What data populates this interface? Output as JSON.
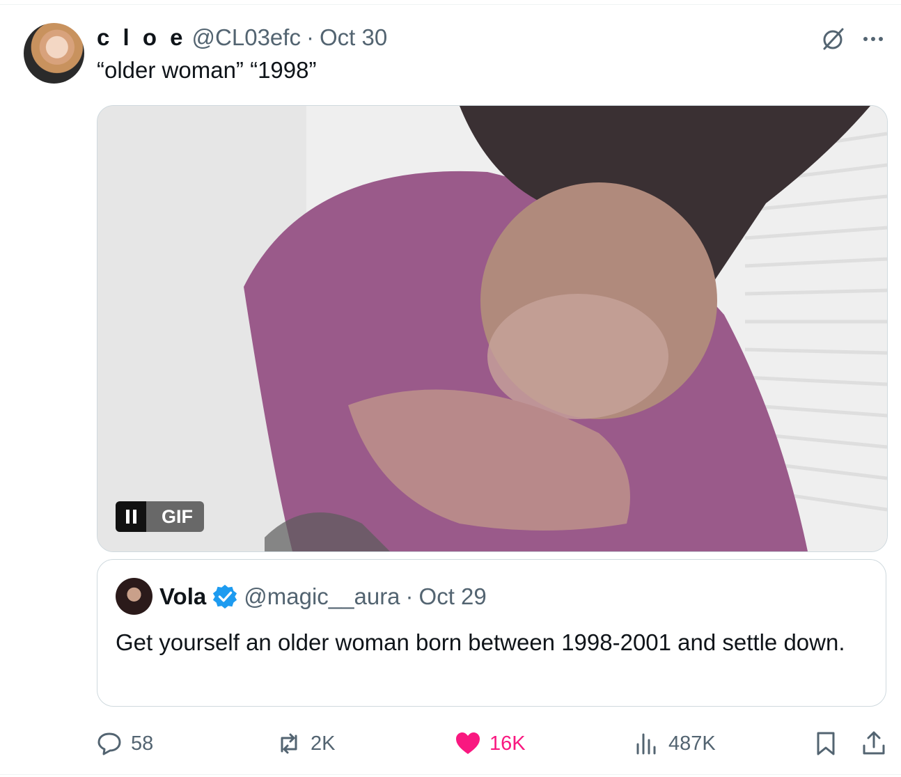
{
  "tweet": {
    "display_name": "c l o e",
    "handle": "@CL03efc",
    "separator": "·",
    "date": "Oct 30",
    "text": "“older woman” “1998”",
    "media_badge": "GIF"
  },
  "quoted_tweet": {
    "display_name": "Vola",
    "handle": "@magic__aura",
    "separator": "·",
    "date": "Oct 29",
    "text": "Get yourself an older woman born between 1998-2001 and settle down."
  },
  "actions": {
    "replies": "58",
    "reposts": "2K",
    "likes": "16K",
    "views": "487K"
  },
  "colors": {
    "text": "#0f1419",
    "secondary": "#536471",
    "like": "#f91880",
    "verified": "#1d9bf0",
    "border": "#cfd9de"
  },
  "icons": [
    "grok-icon",
    "more-icon",
    "pause-icon",
    "verified-icon",
    "reply-icon",
    "repost-icon",
    "like-icon",
    "views-icon",
    "bookmark-icon",
    "share-icon"
  ]
}
